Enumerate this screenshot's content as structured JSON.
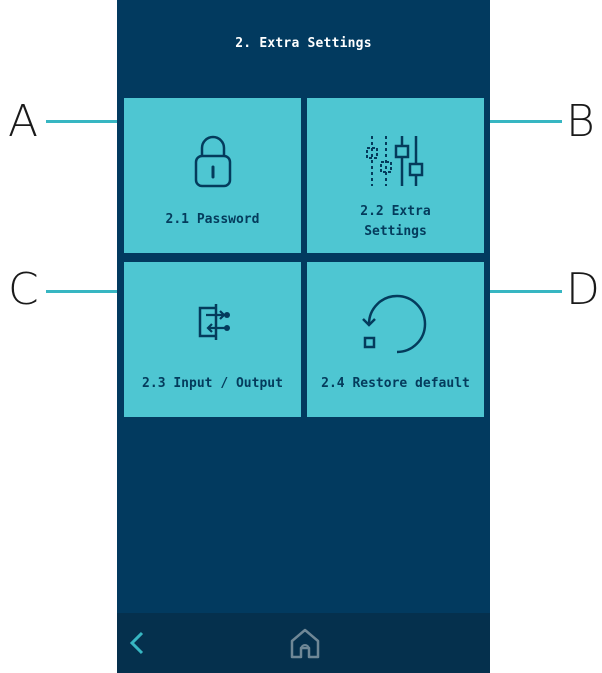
{
  "header": {
    "title": "2. Extra Settings"
  },
  "tiles": [
    {
      "id": "A",
      "label": "2.1 Password",
      "icon": "lock-icon"
    },
    {
      "id": "B",
      "label": "2.2 Extra Settings",
      "label_line1": "2.2 Extra",
      "label_line2": "Settings",
      "icon": "sliders-icon"
    },
    {
      "id": "C",
      "label": "2.3 Input / Output",
      "icon": "input-output-icon"
    },
    {
      "id": "D",
      "label": "2.4 Restore default",
      "icon": "restore-icon"
    }
  ],
  "callouts": [
    "A",
    "B",
    "C",
    "D"
  ],
  "bottom_bar": {
    "back_icon": "chevron-left-icon",
    "home_icon": "home-icon"
  },
  "colors": {
    "screen_bg": "#023a5f",
    "tile_bg": "#4ec6d2",
    "tile_text": "#043b5c",
    "bottom_bar_bg": "#05304d",
    "accent": "#37b6c2"
  }
}
